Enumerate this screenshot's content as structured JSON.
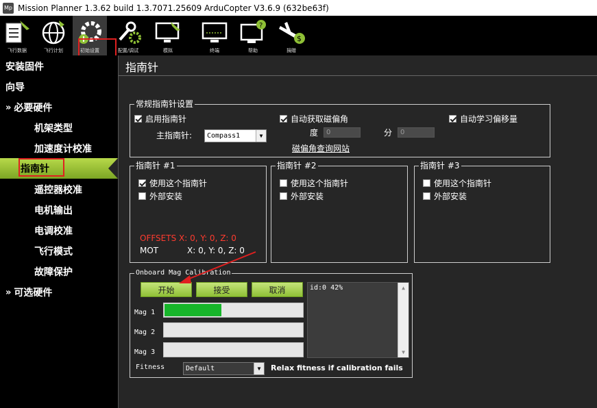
{
  "window": {
    "title": "Mission Planner 1.3.62 build 1.3.7071.25609 ArduCopter V3.6.9 (632be63f)",
    "icon_text": "Mp"
  },
  "toolbar": [
    {
      "label": "飞行数据",
      "icon": "flight-data-icon"
    },
    {
      "label": "飞行计划",
      "icon": "globe-icon"
    },
    {
      "label": "初始设置",
      "icon": "gear-icon"
    },
    {
      "label": "配置/调试",
      "icon": "wrench-gear-icon"
    },
    {
      "label": "模拟",
      "icon": "monitor-plane-icon"
    },
    {
      "label": "终端",
      "icon": "terminal-icon"
    },
    {
      "label": "帮助",
      "icon": "help-monitor-icon"
    },
    {
      "label": "捐赠",
      "icon": "donate-plane-icon"
    }
  ],
  "sidebar": {
    "items": [
      {
        "label": "安装固件"
      },
      {
        "label": "向导"
      },
      {
        "label": "必要硬件",
        "chevron": "»"
      },
      {
        "label": "机架类型"
      },
      {
        "label": "加速度计校准"
      },
      {
        "label": "指南针"
      },
      {
        "label": "遥控器校准"
      },
      {
        "label": "电机输出"
      },
      {
        "label": "电调校准"
      },
      {
        "label": "飞行模式"
      },
      {
        "label": "故障保护"
      },
      {
        "label": "可选硬件",
        "chevron": "»"
      }
    ]
  },
  "page": {
    "title": "指南针"
  },
  "general": {
    "title": "常规指南针设置",
    "enable_label": "启用指南针",
    "enable_checked": true,
    "auto_decl_label": "自动获取磁偏角",
    "auto_decl_checked": true,
    "auto_learn_label": "自动学习偏移量",
    "auto_learn_checked": true,
    "primary_label": "主指南针:",
    "primary_value": "Compass1",
    "deg_label": "度",
    "deg_value": "0",
    "min_label": "分",
    "min_value": "0",
    "decl_link": "磁偏角查询网站"
  },
  "compass1": {
    "title": "指南针 #1",
    "use_label": "使用这个指南针",
    "use_checked": true,
    "external_label": "外部安装",
    "external_checked": false,
    "offsets_text": "OFFSETS  X: 0,   Y: 0,   Z: 0",
    "mot_label": "MOT",
    "mot_values": "X: 0,   Y: 0,   Z: 0"
  },
  "compass2": {
    "title": "指南针 #2",
    "use_label": "使用这个指南针",
    "use_checked": false,
    "external_label": "外部安装",
    "external_checked": false
  },
  "compass3": {
    "title": "指南针 #3",
    "use_label": "使用这个指南针",
    "use_checked": false,
    "external_label": "外部安装",
    "external_checked": false
  },
  "onboard": {
    "title": "Onboard Mag Calibration",
    "start_label": "开始",
    "accept_label": "接受",
    "cancel_label": "取消",
    "mag1_label": "Mag 1",
    "mag1_progress": 0.42,
    "mag2_label": "Mag 2",
    "mag2_progress": 0,
    "mag3_label": "Mag 3",
    "mag3_progress": 0,
    "log_text": "id:0 42%",
    "fitness_label": "Fitness",
    "fitness_value": "Default",
    "relax_label": "Relax fitness if calibration fails"
  },
  "colors": {
    "accent_green": "#8fc036",
    "progress_green": "#17b52a",
    "highlight_red": "#e02020",
    "offsets_red": "#ff3b2f"
  }
}
